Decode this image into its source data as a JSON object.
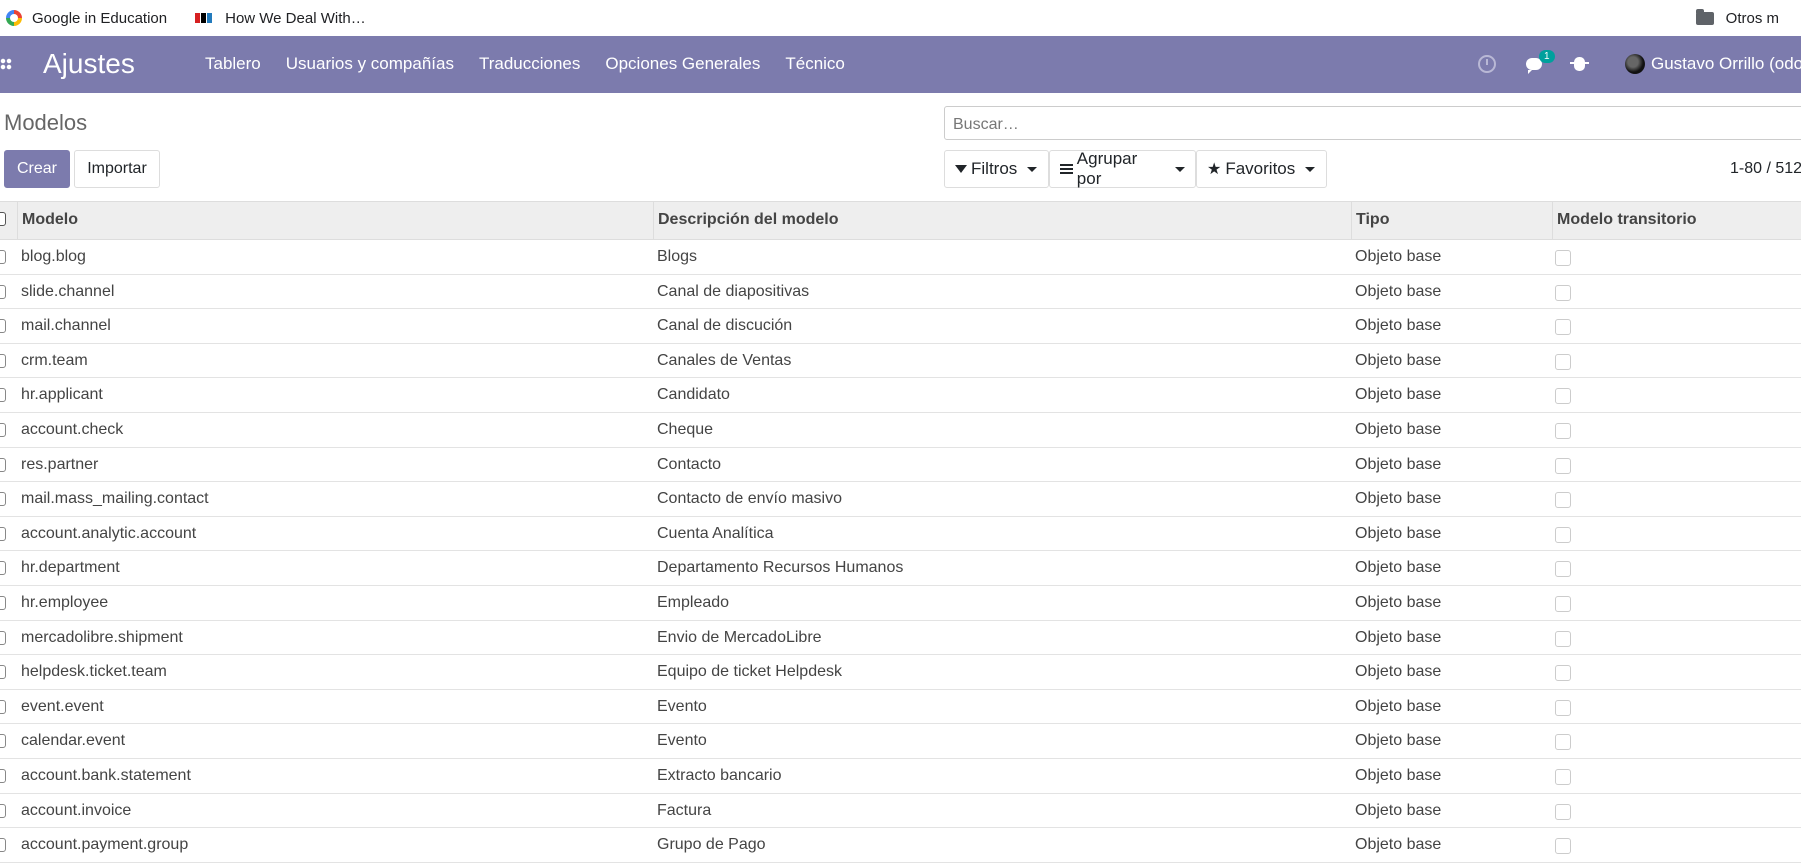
{
  "bookmarks": {
    "items": [
      {
        "label": "Google in Education",
        "icon": "google-icon"
      },
      {
        "label": "How We Deal With…",
        "icon": "npr-icon"
      }
    ],
    "other": "Otros m"
  },
  "navbar": {
    "brand": "Ajustes",
    "menu": [
      "Tablero",
      "Usuarios y compañías",
      "Traducciones",
      "Opciones Generales",
      "Técnico"
    ],
    "chat_badge": "1",
    "user": "Gustavo Orrillo (odo",
    "color": "#7c7bad"
  },
  "control": {
    "title": "Modelos",
    "search_placeholder": "Buscar…",
    "create": "Crear",
    "import": "Importar",
    "filters": "Filtros",
    "group_by": "Agrupar por",
    "favorites": "Favoritos",
    "pager": "1-80 / 512"
  },
  "table": {
    "headers": [
      "Modelo",
      "Descripción del modelo",
      "Tipo",
      "Modelo transitorio"
    ],
    "rows": [
      [
        "blog.blog",
        "Blogs",
        "Objeto base"
      ],
      [
        "slide.channel",
        "Canal de diapositivas",
        "Objeto base"
      ],
      [
        "mail.channel",
        "Canal de discución",
        "Objeto base"
      ],
      [
        "crm.team",
        "Canales de Ventas",
        "Objeto base"
      ],
      [
        "hr.applicant",
        "Candidato",
        "Objeto base"
      ],
      [
        "account.check",
        "Cheque",
        "Objeto base"
      ],
      [
        "res.partner",
        "Contacto",
        "Objeto base"
      ],
      [
        "mail.mass_mailing.contact",
        "Contacto de envío masivo",
        "Objeto base"
      ],
      [
        "account.analytic.account",
        "Cuenta Analítica",
        "Objeto base"
      ],
      [
        "hr.department",
        "Departamento Recursos Humanos",
        "Objeto base"
      ],
      [
        "hr.employee",
        "Empleado",
        "Objeto base"
      ],
      [
        "mercadolibre.shipment",
        "Envio de MercadoLibre",
        "Objeto base"
      ],
      [
        "helpdesk.ticket.team",
        "Equipo de ticket Helpdesk",
        "Objeto base"
      ],
      [
        "event.event",
        "Evento",
        "Objeto base"
      ],
      [
        "calendar.event",
        "Evento",
        "Objeto base"
      ],
      [
        "account.bank.statement",
        "Extracto bancario",
        "Objeto base"
      ],
      [
        "account.invoice",
        "Factura",
        "Objeto base"
      ],
      [
        "account.payment.group",
        "Grupo de Pago",
        "Objeto base"
      ]
    ]
  }
}
